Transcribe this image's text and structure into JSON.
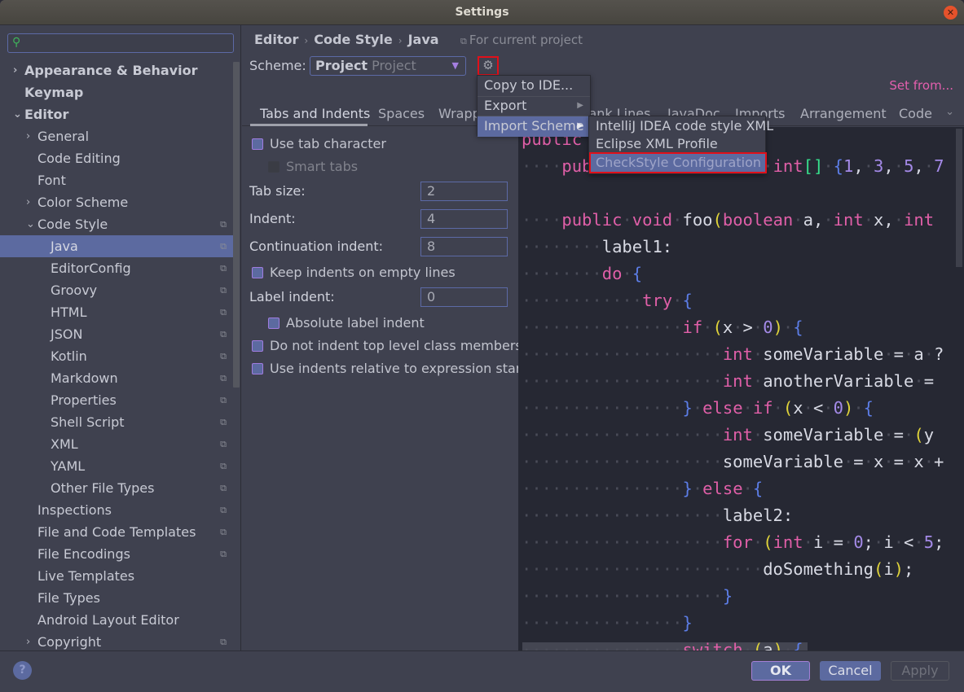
{
  "window": {
    "title": "Settings"
  },
  "search": {
    "placeholder": "",
    "value": ""
  },
  "sidebar": {
    "items": [
      {
        "label": "Appearance & Behavior",
        "level": 0,
        "expander": "collapsed",
        "bold": true,
        "project": false
      },
      {
        "label": "Keymap",
        "level": 0,
        "expander": "none",
        "bold": true,
        "project": false
      },
      {
        "label": "Editor",
        "level": 0,
        "expander": "expanded",
        "bold": true,
        "project": false
      },
      {
        "label": "General",
        "level": 1,
        "expander": "collapsed",
        "project": false
      },
      {
        "label": "Code Editing",
        "level": 1,
        "expander": "none",
        "project": false
      },
      {
        "label": "Font",
        "level": 1,
        "expander": "none",
        "project": false
      },
      {
        "label": "Color Scheme",
        "level": 1,
        "expander": "collapsed",
        "project": false
      },
      {
        "label": "Code Style",
        "level": 1,
        "expander": "expanded",
        "project": true
      },
      {
        "label": "Java",
        "level": 2,
        "expander": "none",
        "project": true,
        "selected": true
      },
      {
        "label": "EditorConfig",
        "level": 2,
        "expander": "none",
        "project": true
      },
      {
        "label": "Groovy",
        "level": 2,
        "expander": "none",
        "project": true
      },
      {
        "label": "HTML",
        "level": 2,
        "expander": "none",
        "project": true
      },
      {
        "label": "JSON",
        "level": 2,
        "expander": "none",
        "project": true
      },
      {
        "label": "Kotlin",
        "level": 2,
        "expander": "none",
        "project": true
      },
      {
        "label": "Markdown",
        "level": 2,
        "expander": "none",
        "project": true
      },
      {
        "label": "Properties",
        "level": 2,
        "expander": "none",
        "project": true
      },
      {
        "label": "Shell Script",
        "level": 2,
        "expander": "none",
        "project": true
      },
      {
        "label": "XML",
        "level": 2,
        "expander": "none",
        "project": true
      },
      {
        "label": "YAML",
        "level": 2,
        "expander": "none",
        "project": true
      },
      {
        "label": "Other File Types",
        "level": 2,
        "expander": "none",
        "project": true
      },
      {
        "label": "Inspections",
        "level": 1,
        "expander": "none",
        "project": true
      },
      {
        "label": "File and Code Templates",
        "level": 1,
        "expander": "none",
        "project": true
      },
      {
        "label": "File Encodings",
        "level": 1,
        "expander": "none",
        "project": true
      },
      {
        "label": "Live Templates",
        "level": 1,
        "expander": "none",
        "project": false
      },
      {
        "label": "File Types",
        "level": 1,
        "expander": "none",
        "project": false
      },
      {
        "label": "Android Layout Editor",
        "level": 1,
        "expander": "none",
        "project": false
      },
      {
        "label": "Copyright",
        "level": 1,
        "expander": "collapsed",
        "project": true
      }
    ]
  },
  "breadcrumb": {
    "items": [
      "Editor",
      "Code Style",
      "Java"
    ],
    "separator": "›",
    "scope": "For current project"
  },
  "scheme": {
    "label": "Scheme:",
    "name": "Project",
    "sub": "Project"
  },
  "set_from": "Set from...",
  "tabs": [
    "Tabs and Indents",
    "Spaces",
    "Wrapping and Braces",
    "Blank Lines",
    "JavaDoc",
    "Imports",
    "Arrangement",
    "Code Generation"
  ],
  "tabs_visible": {
    "t0": "Tabs and Indents",
    "t1": "Spaces",
    "t2": "Wrapp",
    "t3": "lank Lines",
    "t4": "JavaDoc",
    "t5": "Imports",
    "t6": "Arrangement",
    "t7": "Code"
  },
  "active_tab": "Tabs and Indents",
  "settings": {
    "use_tab_character": {
      "label": "Use tab character",
      "checked": false
    },
    "smart_tabs": {
      "label": "Smart tabs",
      "checked": false,
      "enabled": false
    },
    "tab_size": {
      "label": "Tab size:",
      "value": "2"
    },
    "indent": {
      "label": "Indent:",
      "value": "4"
    },
    "continuation_indent": {
      "label": "Continuation indent:",
      "value": "8"
    },
    "keep_indents_empty": {
      "label": "Keep indents on empty lines",
      "checked": false
    },
    "label_indent": {
      "label": "Label indent:",
      "value": "0"
    },
    "absolute_label_indent": {
      "label": "Absolute label indent",
      "checked": false
    },
    "no_indent_top_level": {
      "label": "Do not indent top level class members",
      "checked": false
    },
    "indents_relative": {
      "label": "Use indents relative to expression start",
      "checked": false
    }
  },
  "gear_menu": {
    "items": [
      {
        "label": "Copy to IDE...",
        "submenu": false
      },
      {
        "label": "Export",
        "submenu": true
      },
      {
        "label": "Import Scheme",
        "submenu": true,
        "active": true
      }
    ]
  },
  "import_submenu": {
    "items": [
      {
        "label": "IntelliJ IDEA code style XML"
      },
      {
        "label": "Eclipse XML Profile"
      },
      {
        "label": "CheckStyle Configuration",
        "highlighted": true
      }
    ]
  },
  "code_preview": {
    "lines": [
      "public",
      "    public int[] X = new int[] {1, 3, 5, 7",
      "",
      "    public void foo(boolean a, int x, int",
      "        label1:",
      "        do {",
      "            try {",
      "                if (x > 0) {",
      "                    int someVariable = a ?",
      "                    int anotherVariable =",
      "                } else if (x < 0) {",
      "                    int someVariable = (y",
      "                    someVariable = x = x +",
      "                } else {",
      "                    label2:",
      "                    for (int i = 0; i < 5;",
      "                        doSomething(i);",
      "                    }",
      "                }",
      "                switch (a) {"
    ]
  },
  "buttons": {
    "ok": "OK",
    "cancel": "Cancel",
    "apply": "Apply",
    "help": "?"
  },
  "colors": {
    "accent": "#5c6aa0",
    "highlight_border": "#e0101a",
    "keyword": "#e05fa8",
    "link": "#e45fae",
    "close_button": "#e5522b"
  },
  "icons": {
    "search": "search-icon",
    "gear": "gear-icon",
    "close": "close-icon",
    "project_scope": "project-scope-icon",
    "help": "help-icon"
  }
}
